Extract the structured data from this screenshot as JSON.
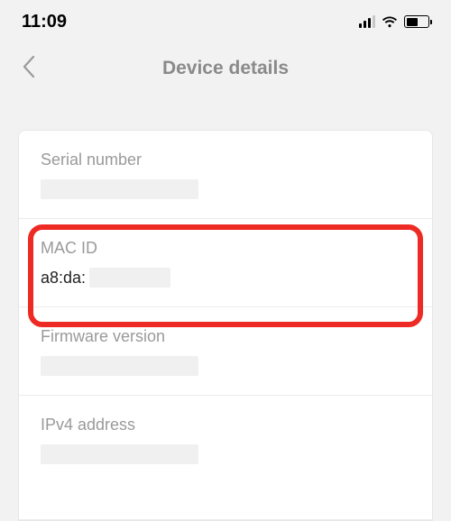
{
  "status": {
    "time": "11:09"
  },
  "nav": {
    "title": "Device details"
  },
  "details": {
    "serial_label": "Serial number",
    "mac_label": "MAC ID",
    "mac_value": "a8:da:",
    "firmware_label": "Firmware version",
    "ipv4_label": "IPv4 address"
  },
  "colors": {
    "highlight": "#ee2a24"
  }
}
